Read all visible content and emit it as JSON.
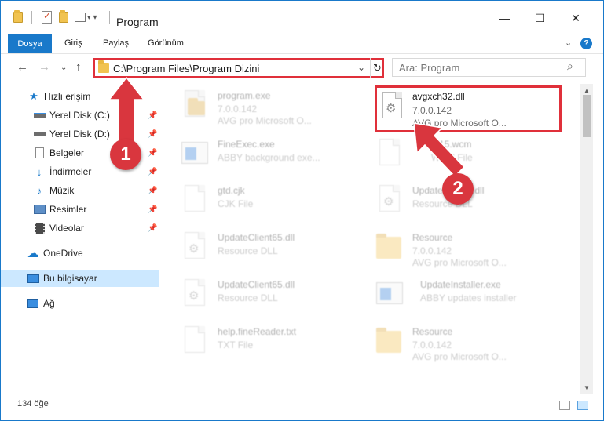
{
  "window": {
    "title": "Program",
    "minimize": "—",
    "maximize": "☐",
    "close": "✕"
  },
  "ribbon": {
    "tabs": [
      "Dosya",
      "Giriş",
      "Paylaş",
      "Görünüm"
    ],
    "help": "?"
  },
  "address": {
    "path": "C:\\Program Files\\Program Dizini",
    "search_placeholder": "Ara: Program"
  },
  "nav": {
    "items": [
      {
        "label": "Hızlı erişim",
        "icon": "star-icon"
      },
      {
        "label": "Yerel Disk (C:)",
        "icon": "drive-icon",
        "pinned": true
      },
      {
        "label": "Yerel Disk (D:)",
        "icon": "drive-icon",
        "pinned": true
      },
      {
        "label": "Belgeler",
        "icon": "documents-icon",
        "pinned": true
      },
      {
        "label": "İndirmeler",
        "icon": "download-icon",
        "pinned": true
      },
      {
        "label": "Müzik",
        "icon": "music-icon",
        "pinned": true
      },
      {
        "label": "Resimler",
        "icon": "pictures-icon",
        "pinned": true
      },
      {
        "label": "Videolar",
        "icon": "video-icon",
        "pinned": true
      },
      {
        "label": "OneDrive",
        "icon": "cloud-icon"
      },
      {
        "label": "Bu bilgisayar",
        "icon": "computer-icon",
        "selected": true
      },
      {
        "label": "Ağ",
        "icon": "network-icon"
      }
    ]
  },
  "files": [
    {
      "name": "program.exe",
      "line1": "7.0.0.142",
      "line2": "AVG pro Microsoft O...",
      "icon": "exe-icon",
      "faded": true
    },
    {
      "name": "avgxch32.dll",
      "line1": "7.0.0.142",
      "line2": "AVG pro Microsoft O...",
      "icon": "dll-icon",
      "highlighted": true
    },
    {
      "name": "FineExec.exe",
      "line1": "ABBY background exe...",
      "line2": "",
      "icon": "exe-icon",
      "faded": true
    },
    {
      "name": "MP15.wcm",
      "line1": "WCM File",
      "line2": "",
      "icon": "document-icon",
      "faded": true
    },
    {
      "name": "gtd.cjk",
      "line1": "CJK File",
      "line2": "",
      "icon": "document-icon",
      "faded": true
    },
    {
      "name": "UpdateClient5.dll",
      "line1": "Resource DLL",
      "line2": "",
      "icon": "dll-icon",
      "faded": true
    },
    {
      "name": "UpdateClient65.dll",
      "line1": "Resource DLL",
      "line2": "",
      "icon": "dll-icon",
      "faded": true
    },
    {
      "name": "Resource",
      "line1": "7.0.0.142",
      "line2": "AVG pro Microsoft O...",
      "icon": "folder-icon",
      "faded": true
    },
    {
      "name": "UpdateClient65.dll",
      "line1": "Resource DLL",
      "line2": "",
      "icon": "dll-icon",
      "faded": true
    },
    {
      "name": "UpdateInstaller.exe",
      "line1": "ABBY updates installer",
      "line2": "",
      "icon": "exe-icon",
      "faded": true
    },
    {
      "name": "help.fineReader.txt",
      "line1": "TXT File",
      "line2": "",
      "icon": "document-icon",
      "faded": true
    },
    {
      "name": "Resource",
      "line1": "7.0.0.142",
      "line2": "AVG pro Microsoft O...",
      "icon": "folder-icon",
      "faded": true
    }
  ],
  "status": {
    "count": "134 öğe"
  },
  "annotations": {
    "step1": "1",
    "step2": "2",
    "color": "#d9363e"
  }
}
